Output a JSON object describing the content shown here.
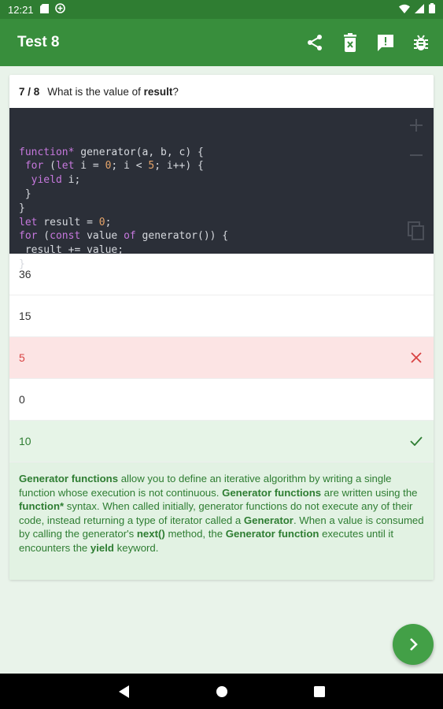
{
  "status_bar": {
    "time": "12:21"
  },
  "app_bar": {
    "title": "Test 8",
    "actions": [
      "share-icon",
      "delete-icon",
      "feedback-icon",
      "bug-icon"
    ]
  },
  "question": {
    "counter": "7 / 8",
    "text_prefix": "What is the value of ",
    "text_bold": "result",
    "text_suffix": "?"
  },
  "code": {
    "lines": [
      [
        [
          "kw",
          "function*"
        ],
        [
          "t",
          " generator(a, b, c) {"
        ]
      ],
      [
        [
          "t",
          " "
        ],
        [
          "kw",
          "for"
        ],
        [
          "t",
          " ("
        ],
        [
          "kw",
          "let"
        ],
        [
          "t",
          " i = "
        ],
        [
          "num",
          "0"
        ],
        [
          "t",
          "; i < "
        ],
        [
          "num",
          "5"
        ],
        [
          "t",
          "; i++) {"
        ]
      ],
      [
        [
          "t",
          "  "
        ],
        [
          "kw",
          "yield"
        ],
        [
          "t",
          " i;"
        ]
      ],
      [
        [
          "t",
          " }"
        ]
      ],
      [
        [
          "t",
          "}"
        ]
      ],
      [
        [
          "kw",
          "let"
        ],
        [
          "t",
          " result = "
        ],
        [
          "num",
          "0"
        ],
        [
          "t",
          ";"
        ]
      ],
      [
        [
          "kw",
          "for"
        ],
        [
          "t",
          " ("
        ],
        [
          "kw",
          "const"
        ],
        [
          "t",
          " value "
        ],
        [
          "kw",
          "of"
        ],
        [
          "t",
          " generator()) {"
        ]
      ],
      [
        [
          "t",
          " result += value;"
        ]
      ],
      [
        [
          "t",
          "}"
        ]
      ]
    ]
  },
  "answers": [
    {
      "label": "36",
      "state": "normal"
    },
    {
      "label": "15",
      "state": "normal"
    },
    {
      "label": "5",
      "state": "wrong"
    },
    {
      "label": "0",
      "state": "normal"
    },
    {
      "label": "10",
      "state": "right"
    }
  ],
  "explanation": [
    [
      "b",
      "Generator functions"
    ],
    [
      "t",
      " allow you to define an iterative algorithm by writing a single function whose execution is not continuous. "
    ],
    [
      "b",
      "Generator functions"
    ],
    [
      "t",
      " are written using the "
    ],
    [
      "b",
      "function*"
    ],
    [
      "t",
      " syntax. When called initially, generator functions do not execute any of their code, instead returning a type of iterator called a "
    ],
    [
      "b",
      "Generator"
    ],
    [
      "t",
      ". When a value is consumed by calling the generator's "
    ],
    [
      "b",
      "next()"
    ],
    [
      "t",
      " method, the "
    ],
    [
      "b",
      "Generator function"
    ],
    [
      "t",
      " executes until it encounters the "
    ],
    [
      "b",
      "yield"
    ],
    [
      "t",
      " keyword."
    ]
  ],
  "colors": {
    "primary": "#388e3c",
    "status": "#2f7d32",
    "fab": "#43a047",
    "wrong": "#d84343",
    "right": "#2e7d32"
  }
}
